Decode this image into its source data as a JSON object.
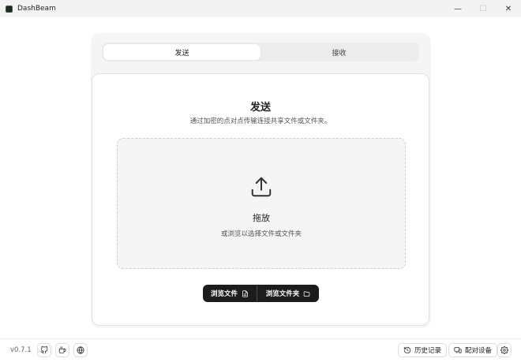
{
  "window": {
    "title": "DashBeam",
    "minimize_glyph": "—",
    "maximize_glyph": "☐",
    "close_glyph": "✕"
  },
  "tabs": [
    {
      "label": "发送",
      "active": true
    },
    {
      "label": "接收",
      "active": false
    }
  ],
  "send": {
    "title": "发送",
    "description": "通过加密的点对点传输连接共享文件或文件夹。"
  },
  "dropzone": {
    "icon": "upload-icon",
    "title": "拖放",
    "subtitle": "或浏览以选择文件或文件夹"
  },
  "actions": {
    "browse_files": "浏览文件",
    "browse_files_icon": "file-icon",
    "browse_folder": "浏览文件夹",
    "browse_folder_icon": "folder-icon"
  },
  "footer": {
    "version": "v0.7.1",
    "left_icons": [
      "github-icon",
      "coffee-icon",
      "globe-icon"
    ],
    "history_label": "历史记录",
    "history_icon": "history-icon",
    "pair_label": "配对设备",
    "pair_icon": "devices-icon",
    "settings_icon": "gear-icon"
  },
  "colors": {
    "primary_button": "#1c1c1c",
    "panel_background": "#f5f5f5"
  }
}
